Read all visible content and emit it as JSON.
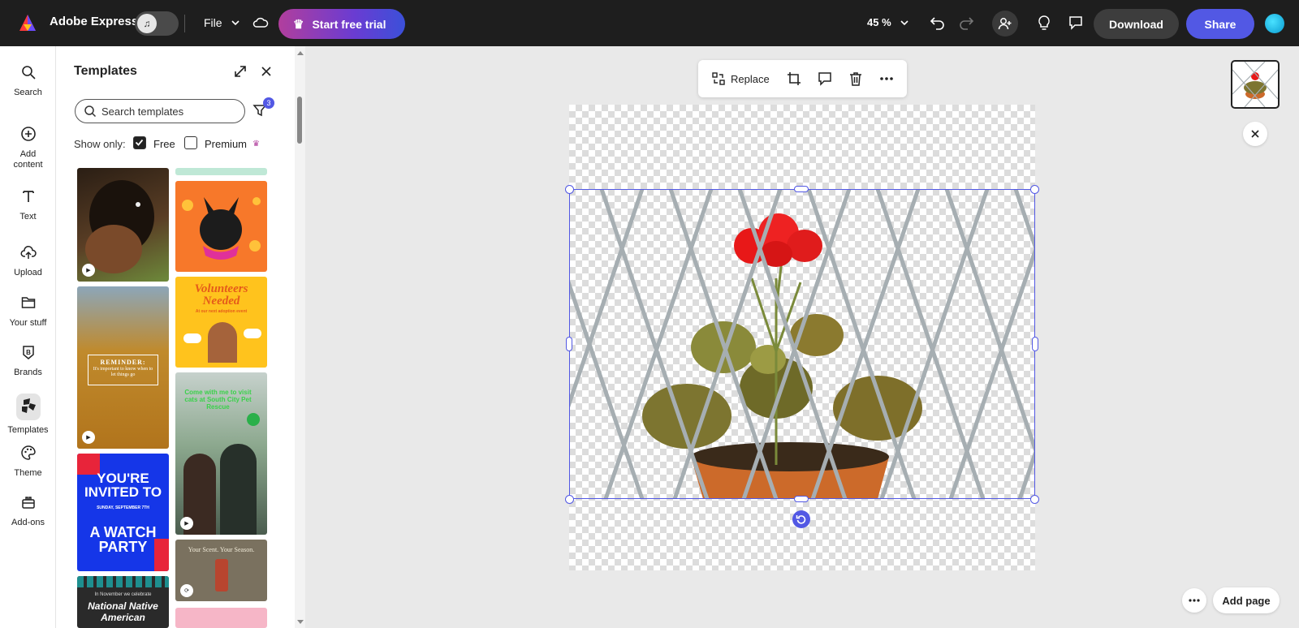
{
  "app": {
    "name": "Adobe Express"
  },
  "topbar": {
    "file_label": "File",
    "trial_label": "Start free trial",
    "zoom_label": "45 %",
    "download_label": "Download",
    "share_label": "Share"
  },
  "rail": {
    "items": [
      {
        "label": "Search",
        "icon": "search-icon"
      },
      {
        "label": "Add content",
        "icon": "plus-circle-icon"
      },
      {
        "label": "Text",
        "icon": "text-icon"
      },
      {
        "label": "Upload",
        "icon": "upload-icon"
      },
      {
        "label": "Your stuff",
        "icon": "folder-icon"
      },
      {
        "label": "Brands",
        "icon": "brand-icon"
      },
      {
        "label": "Templates",
        "icon": "templates-icon"
      },
      {
        "label": "Theme",
        "icon": "palette-icon"
      },
      {
        "label": "Add-ons",
        "icon": "addons-icon"
      }
    ],
    "active": "Templates"
  },
  "panel": {
    "title": "Templates",
    "search_placeholder": "Search templates",
    "filter_count": "3",
    "show_only_label": "Show only:",
    "free_label": "Free",
    "free_checked": true,
    "premium_label": "Premium",
    "premium_checked": false,
    "templates": {
      "volunteers_title": "Volunteers Needed",
      "volunteers_sub": "At our next adoption event",
      "reminder_title": "REMINDER:",
      "reminder_sub": "It's important to know when to let things go",
      "cats_title": "Come with me to visit cats at South City Pet Rescue",
      "invited_line1": "YOU'RE INVITED TO",
      "invited_date": "SUNDAY, SEPTEMBER 7TH",
      "invited_line2": "A WATCH PARTY",
      "scent_title": "Your Scent. Your Season.",
      "native_line1": "In November we celebrate",
      "native_line2": "National Native American"
    }
  },
  "context_toolbar": {
    "replace_label": "Replace"
  },
  "footer": {
    "add_page_label": "Add page"
  }
}
